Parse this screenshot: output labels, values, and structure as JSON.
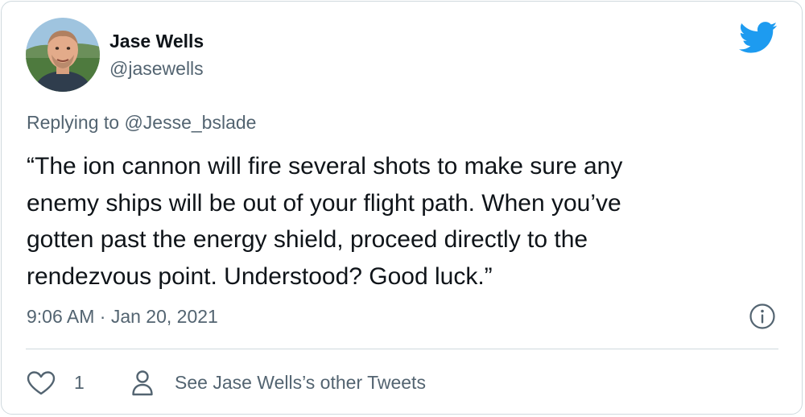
{
  "author": {
    "name": "Jase Wells",
    "handle": "@jasewells"
  },
  "reply": {
    "text": "Replying to @Jesse_bslade"
  },
  "tweet": {
    "lines": [
      "“The ion cannon will fire several shots to make sure any",
      "enemy ships will be out of your flight path. When you’ve",
      "gotten past the energy shield, proceed directly to the",
      "rendezvous point. Understood? Good luck.”"
    ],
    "timestamp": "9:06 AM · Jan 20, 2021"
  },
  "actions": {
    "like_count": "1",
    "other_tweets_label": "See Jase Wells’s other Tweets"
  },
  "icons": {
    "brand": "twitter-bird-icon",
    "info": "info-icon",
    "like": "heart-icon",
    "profile": "person-icon"
  },
  "colors": {
    "brand": "#1d9bf0",
    "text": "#0f1419",
    "secondary": "#536471",
    "border": "#cfd9de"
  }
}
